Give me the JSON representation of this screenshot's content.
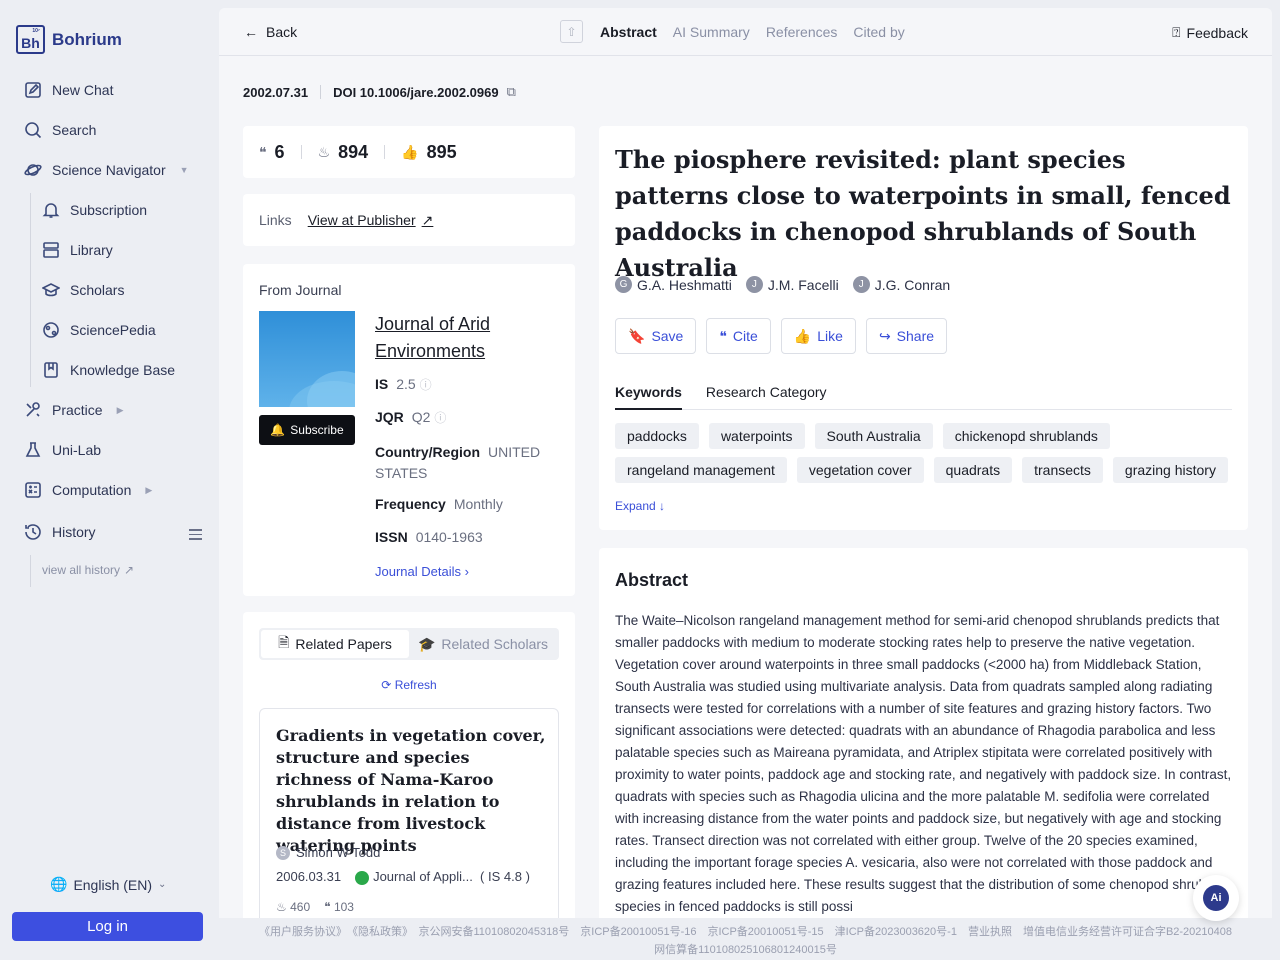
{
  "brand": {
    "name": "Bohrium",
    "logo_main": "Bh",
    "logo_small": "10⁷"
  },
  "sidebar": {
    "items": [
      {
        "label": "New Chat",
        "icon": "edit-icon"
      },
      {
        "label": "Search",
        "icon": "search-icon"
      },
      {
        "label": "Science Navigator",
        "icon": "planet-icon"
      },
      {
        "label": "Subscription",
        "icon": "bell-icon"
      },
      {
        "label": "Library",
        "icon": "library-icon"
      },
      {
        "label": "Scholars",
        "icon": "graduation-cap-icon"
      },
      {
        "label": "SciencePedia",
        "icon": "globe-icon"
      },
      {
        "label": "Knowledge Base",
        "icon": "book-icon"
      },
      {
        "label": "Practice",
        "icon": "tools-icon"
      },
      {
        "label": "Uni-Lab",
        "icon": "flask-icon"
      },
      {
        "label": "Computation",
        "icon": "calculator-icon"
      },
      {
        "label": "History",
        "icon": "history-icon"
      }
    ],
    "view_all": "view all history",
    "language": "English (EN)",
    "login": "Log in"
  },
  "topbar": {
    "back": "Back",
    "tabs": [
      "Abstract",
      "AI Summary",
      "References",
      "Cited by"
    ],
    "active_tab": "Abstract",
    "feedback": "Feedback"
  },
  "meta": {
    "date": "2002.07.31",
    "doi": "DOI 10.1006/jare.2002.0969"
  },
  "stats": {
    "citations": "6",
    "views": "894",
    "likes": "895"
  },
  "links": {
    "label": "Links",
    "publisher": "View at Publisher"
  },
  "journal": {
    "from": "From Journal",
    "name": "Journal of Arid Environments",
    "subscribe": "Subscribe",
    "is_label": "IS",
    "is_value": "2.5",
    "jqr_label": "JQR",
    "jqr_value": "Q2",
    "country_label": "Country/Region",
    "country_value": "UNITED STATES",
    "freq_label": "Frequency",
    "freq_value": "Monthly",
    "issn_label": "ISSN",
    "issn_value": "0140-1963",
    "details": "Journal Details"
  },
  "related": {
    "tab_papers": "Related Papers",
    "tab_scholars": "Related Scholars",
    "refresh": "Refresh",
    "paper": {
      "title": "Gradients in vegetation cover, structure and species richness of Nama-Karoo shrublands in relation to distance from livestock watering points",
      "author_initial": "S",
      "author": "Simon W Todd",
      "date": "2006.03.31",
      "journal": "Journal of Appli...",
      "is": "( IS 4.8 )",
      "views": "460",
      "cites": "103"
    }
  },
  "paper": {
    "title": "The piosphere revisited: plant species patterns close to waterpoints in small, fenced paddocks in chenopod shrublands of South Australia",
    "authors": [
      {
        "initial": "G",
        "name": "G.A. Heshmatti"
      },
      {
        "initial": "J",
        "name": "J.M. Facelli"
      },
      {
        "initial": "J",
        "name": "J.G. Conran"
      }
    ],
    "actions": {
      "save": "Save",
      "cite": "Cite",
      "like": "Like",
      "share": "Share"
    },
    "keyword_tabs": [
      "Keywords",
      "Research Category"
    ],
    "keywords": [
      "paddocks",
      "waterpoints",
      "South Australia",
      "chickenopd shrublands",
      "rangeland management",
      "vegetation cover",
      "quadrats",
      "transects",
      "grazing history"
    ],
    "expand": "Expand"
  },
  "abstract": {
    "heading": "Abstract",
    "text": "The Waite–Nicolson rangeland management method for semi-arid chenopod shrublands predicts that smaller paddocks with medium to moderate stocking rates help to preserve the native vegetation. Vegetation cover around waterpoints in three small paddocks (<2000 ha) from Middleback Station, South Australia was studied using multivariate analysis. Data from quadrats sampled along radiating transects were tested for correlations with a number of site features and grazing history factors. Two significant associations were detected: quadrats with an abundance of Rhagodia parabolica and less palatable species such as Maireana pyramidata, and Atriplex stipitata were correlated positively with proximity to water points, paddock age and stocking rate, and negatively with paddock size. In contrast, quadrats with species such as Rhagodia ulicina and the more palatable M. sedifolia were correlated with increasing distance from the water points and paddock size, but negatively with age and stocking rates. Transect direction was not correlated with either group. Twelve of the 20 species examined, including the important forage species A. vesicaria, also were not correlated with those paddock and grazing features included here. These results suggest that the distribution of some chenopod shrub species in fenced paddocks is still possi"
  },
  "ai_button": "Ai",
  "footer": {
    "line1": "《用户服务协议》　《隐私政策》　京公网安备11010802045318号　京ICP备20010051号-16　京ICP备20010051号-15　津ICP备2023003620号-1　营业执照　增值电信业务经营许可证合字B2-20210408",
    "line2": "网信算备110108025106801240015号"
  }
}
